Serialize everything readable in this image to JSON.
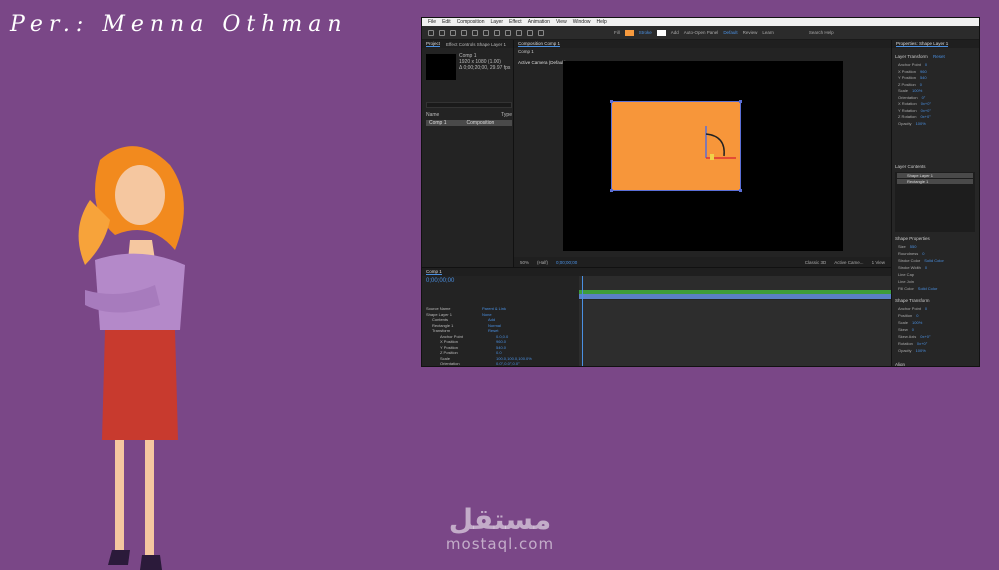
{
  "credit": "Per.: Menna Othman",
  "watermark": {
    "arabic": "مستقل",
    "latin": "mostaql.com"
  },
  "ae": {
    "menu": [
      "File",
      "Edit",
      "Composition",
      "Layer",
      "Effect",
      "Animation",
      "View",
      "Window",
      "Help"
    ],
    "toolbar": {
      "fill_label": "Fill",
      "stroke_label": "Stroke",
      "add_label": "Add",
      "auto_open_label": "Auto-Open Panel",
      "default_label": "Default",
      "review_label": "Review",
      "learn_label": "Learn",
      "search_label": "Search Help"
    },
    "project": {
      "tabs": [
        "Project",
        "Effect Controls Shape Layer 1"
      ],
      "comp_name": "Comp 1",
      "comp_info_1": "1920 x 1080 (1.00)",
      "comp_info_2": "Δ 0;00;20;00, 29.97 fps",
      "col_name": "Name",
      "col_type": "Type",
      "row_name": "Comp 1",
      "row_type": "Composition"
    },
    "comp": {
      "tab": "Composition Comp 1",
      "sub_tab": "Comp 1",
      "camera": "Active Camera (Default)",
      "zoom": "50%",
      "res": "(Half)",
      "time": "0;00;00;00",
      "renderer": "Classic 3D",
      "view": "Active Came...",
      "views": "1 View"
    },
    "props": {
      "tab": "Properties: Shape Layer 1",
      "layer_transform": "Layer Transform",
      "reset": "Reset",
      "rows": [
        {
          "label": "Anchor Point",
          "value": "0"
        },
        {
          "label": "X Position",
          "value": "960"
        },
        {
          "label": "Y Position",
          "value": "540"
        },
        {
          "label": "Z Position",
          "value": "0"
        },
        {
          "label": "Scale",
          "value": "100%"
        },
        {
          "label": "Orientation",
          "value": "0°"
        },
        {
          "label": "X Rotation",
          "value": "0x+0°"
        },
        {
          "label": "Y Rotation",
          "value": "0x+0°"
        },
        {
          "label": "Z Rotation",
          "value": "0x+0°"
        },
        {
          "label": "Opacity",
          "value": "100%"
        }
      ],
      "layer_contents": "Layer Contents",
      "contents": [
        "Shape Layer 1",
        "Rectangle 1"
      ],
      "shape_props": "Shape Properties",
      "shape_rows": [
        {
          "label": "Size",
          "value": "550"
        },
        {
          "label": "Roundness",
          "value": "0"
        },
        {
          "label": "Stroke Color",
          "value": "Solid Color"
        },
        {
          "label": "Stroke Width",
          "value": "0"
        },
        {
          "label": "Line Cap",
          "value": ""
        },
        {
          "label": "Line Join",
          "value": ""
        },
        {
          "label": "Fill Color",
          "value": "Solid Color"
        }
      ],
      "shape_transform": "Shape Transform",
      "st_rows": [
        {
          "label": "Anchor Point",
          "value": "0"
        },
        {
          "label": "Position",
          "value": "0"
        },
        {
          "label": "Scale",
          "value": "100%"
        },
        {
          "label": "Skew",
          "value": "0"
        },
        {
          "label": "Skew Axis",
          "value": "0x+0°"
        },
        {
          "label": "Rotation",
          "value": "0x+0°"
        },
        {
          "label": "Opacity",
          "value": "100%"
        }
      ],
      "align": "Align",
      "audio": "Audio"
    },
    "timeline": {
      "tab": "Comp 1",
      "time": "0;00;00;00",
      "rows": [
        {
          "label": "Source Name",
          "value": "Parent & Link"
        },
        {
          "label": "Shape Layer 1",
          "value": "None"
        },
        {
          "label": "Contents",
          "value": "Add"
        },
        {
          "label": "Rectangle 1",
          "value": "Normal"
        },
        {
          "label": "Transform",
          "value": "Reset"
        },
        {
          "label": "Anchor Point",
          "value": "0.0,0.0"
        },
        {
          "label": "X Position",
          "value": "960.0"
        },
        {
          "label": "Y Position",
          "value": "540.0"
        },
        {
          "label": "Z Position",
          "value": "0.0"
        },
        {
          "label": "Scale",
          "value": "100.0,100.0,100.0%"
        },
        {
          "label": "Orientation",
          "value": "0.0°,0.0°,0.0°"
        },
        {
          "label": "X Rotation",
          "value": "0x+0.0°"
        },
        {
          "label": "Y Rotation",
          "value": "0x+0.0°"
        }
      ]
    }
  },
  "colors": {
    "background": "#7a4787",
    "shape_fill": "#f7963a",
    "accent": "#4a90e2"
  }
}
